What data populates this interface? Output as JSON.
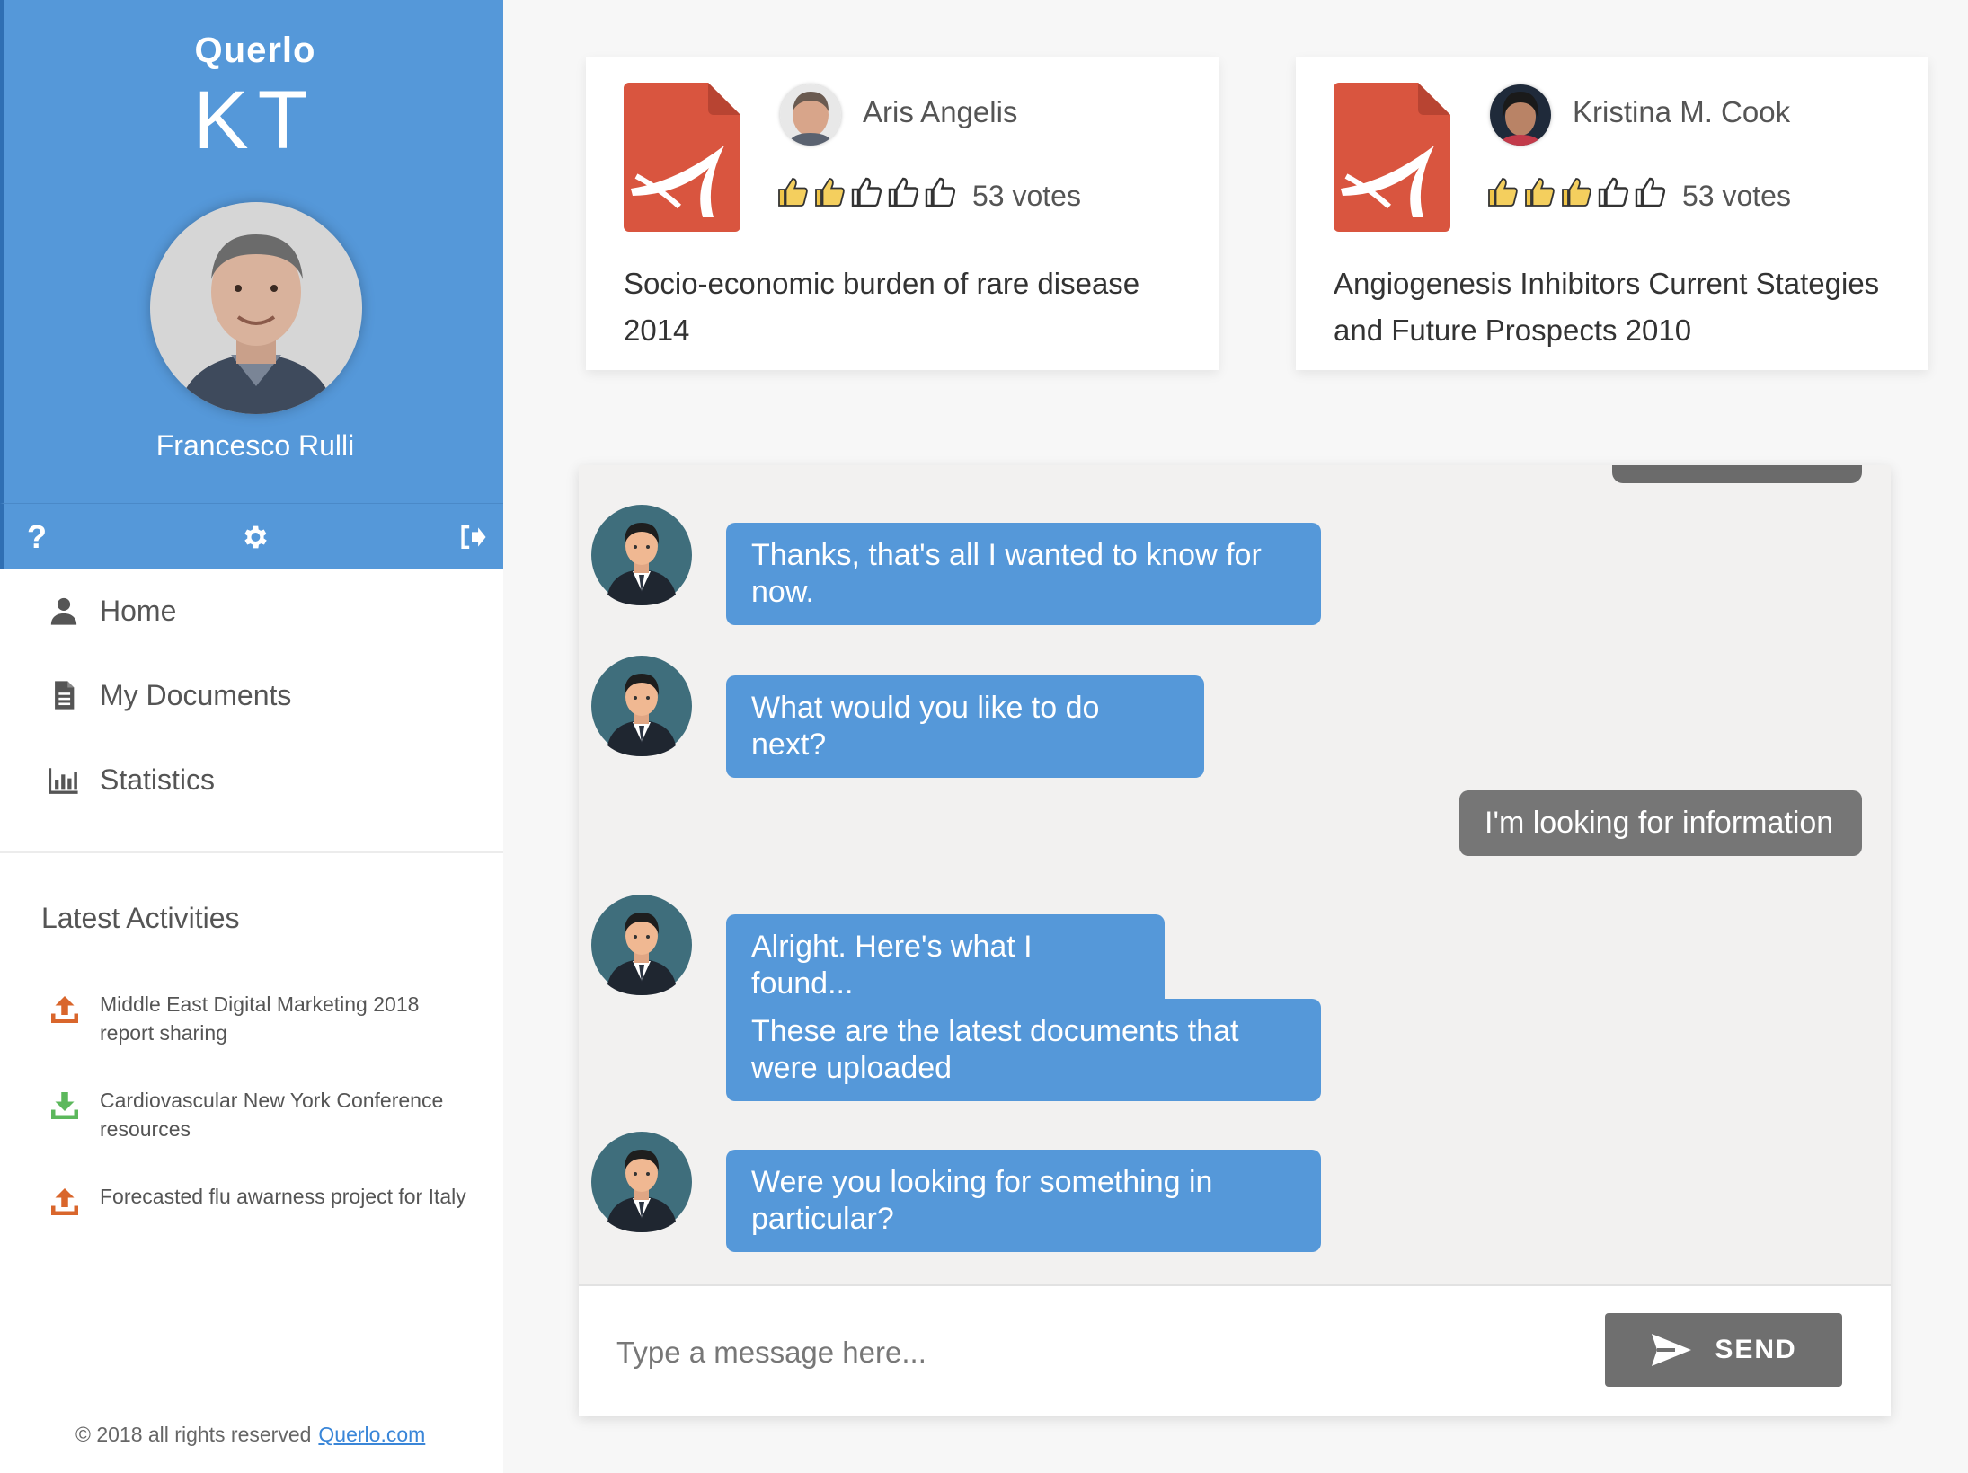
{
  "sidebar": {
    "brand": "Querlo",
    "brand_sub": "KT",
    "user_name": "Francesco Rulli",
    "nav": [
      {
        "label": "Home",
        "icon": "person-icon"
      },
      {
        "label": "My Documents",
        "icon": "document-icon"
      },
      {
        "label": "Statistics",
        "icon": "bar-chart-icon"
      }
    ],
    "latest_title": "Latest Activities",
    "activities": [
      {
        "text": "Middle East Digital Marketing 2018 report sharing",
        "icon": "upload-icon",
        "color": "#d9662c"
      },
      {
        "text": "Cardiovascular New York Conference resources",
        "icon": "download-icon",
        "color": "#5cb85c"
      },
      {
        "text": "Forecasted flu awarness project for Italy",
        "icon": "upload-icon",
        "color": "#d9662c"
      }
    ],
    "footer_text": "© 2018 all rights reserved",
    "footer_link": "Querlo.com"
  },
  "documents": [
    {
      "author": "Aris Angelis",
      "rating": 2,
      "max_rating": 5,
      "votes": "53 votes",
      "title": "Socio-economic burden of rare disease 2014"
    },
    {
      "author": "Kristina M. Cook",
      "rating": 3,
      "max_rating": 5,
      "votes": "53 votes",
      "title": "Angiogenesis Inhibitors Current Stategies and Future Prospects 2010"
    }
  ],
  "chat": {
    "messages": [
      {
        "from": "bot",
        "text": "Thanks, that's all I wanted to know for now."
      },
      {
        "from": "bot",
        "text": "What would you like to do next?"
      },
      {
        "from": "user",
        "text": "I'm looking for information"
      },
      {
        "from": "bot",
        "text": "Alright. Here's what I found..."
      },
      {
        "from": "bot",
        "text": "These are the latest documents that were uploaded"
      },
      {
        "from": "bot",
        "text": "Were you looking for something in particular?"
      }
    ],
    "input_placeholder": "Type a message here...",
    "send_label": "SEND"
  },
  "colors": {
    "accent": "#5598d9",
    "user_bubble": "#767676",
    "pdf_red": "#d9553f",
    "send_button": "#6f6f6f"
  }
}
